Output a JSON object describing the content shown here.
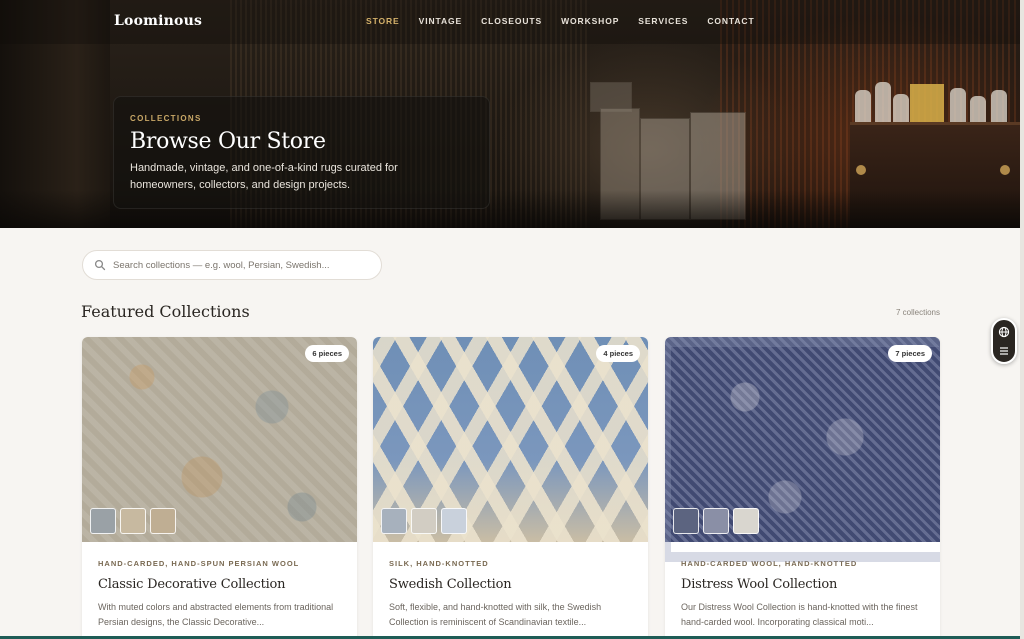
{
  "brand": {
    "name": "Loominous"
  },
  "nav": {
    "items": [
      {
        "label": "STORE",
        "active": true
      },
      {
        "label": "VINTAGE"
      },
      {
        "label": "CLOSEOUTS"
      },
      {
        "label": "WORKSHOP"
      },
      {
        "label": "SERVICES"
      },
      {
        "label": "CONTACT"
      }
    ]
  },
  "hero": {
    "eyebrow": "COLLECTIONS",
    "title": "Browse Our Store",
    "subtitle": "Handmade, vintage, and one-of-a-kind rugs curated for homeowners, collectors, and design projects."
  },
  "search": {
    "placeholder": "Search collections — e.g. wool, Persian, Swedish...",
    "value": ""
  },
  "featured": {
    "title": "Featured Collections",
    "count": "7 collections",
    "cards": [
      {
        "badge": "6 pieces",
        "tag": "HAND-CARDED, HAND-SPUN PERSIAN WOOL",
        "title": "Classic Decorative Collection",
        "desc": "With muted colors and abstracted elements from traditional Persian designs, the Classic Decorative..."
      },
      {
        "badge": "4 pieces",
        "tag": "SILK, HAND-KNOTTED",
        "title": "Swedish Collection",
        "desc": "Soft, flexible, and hand-knotted with silk, the Swedish Collection is reminiscent of Scandinavian textile..."
      },
      {
        "badge": "7 pieces",
        "tag": "HAND-CARDED WOOL, HAND-KNOTTED",
        "title": "Distress Wool Collection",
        "desc": "Our Distress Wool Collection is hand-knotted with the finest hand-carded wool. Incorporating classical moti..."
      }
    ]
  },
  "widget": {
    "icons": [
      "globe-icon",
      "menu-lines-icon"
    ]
  },
  "colors": {
    "accent": "#d4b16a",
    "ink": "#2a2622",
    "background": "#f7f5f2"
  }
}
